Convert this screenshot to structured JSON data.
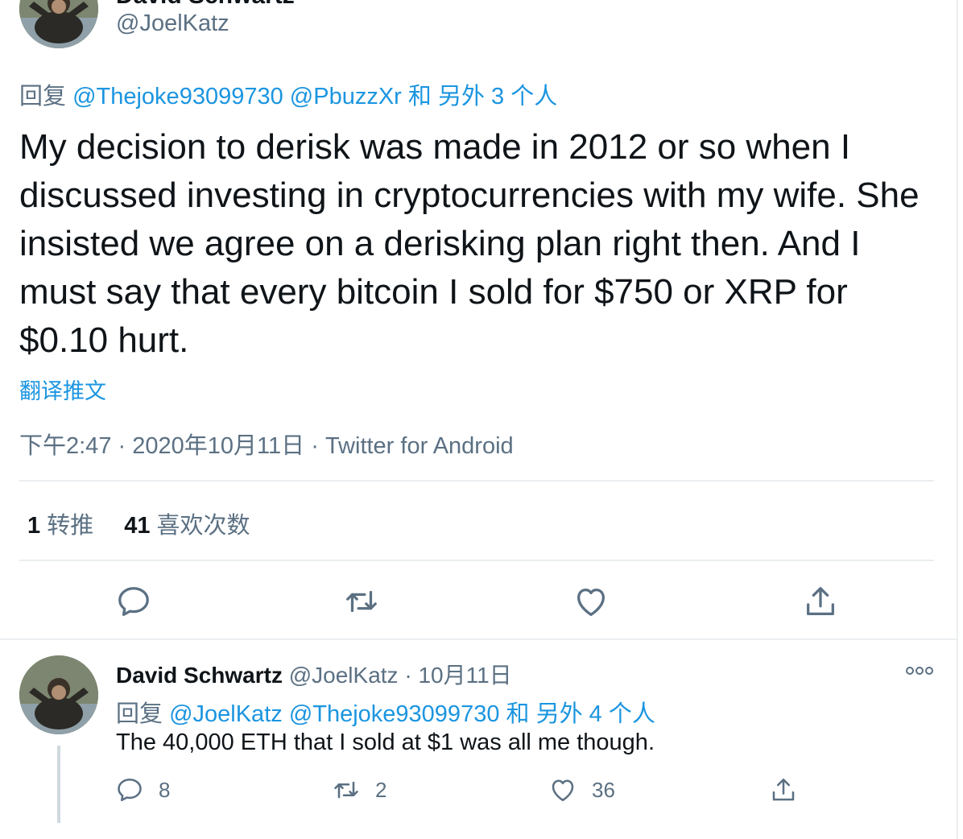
{
  "colors": {
    "text": "#0f1419",
    "secondary": "#5b7083",
    "link": "#1b95e0",
    "divider": "#ebeef0"
  },
  "main_tweet": {
    "author_name": "David Schwartz",
    "handle": "@JoelKatz",
    "reply_prefix": "回复",
    "reply_mention_1": "@Thejoke93099730",
    "reply_mention_2": "@PbuzzXr",
    "reply_suffix": "和 另外 3 个人",
    "text": "My decision to derisk was made in 2012 or so when I discussed investing in cryptocurrencies with my wife. She insisted we agree on a derisking plan right then. And I must say that every bitcoin I sold for $750 or XRP for $0.10 hurt.",
    "translate_label": "翻译推文",
    "time": "下午2:47",
    "separator": "·",
    "date": "2020年10月11日",
    "source": "Twitter for Android",
    "retweet_count": "1",
    "retweet_label": "转推",
    "like_count": "41",
    "like_label": "喜欢次数",
    "actions": [
      "reply-icon",
      "retweet-icon",
      "like-icon",
      "share-icon"
    ]
  },
  "reply_tweet": {
    "author_name": "David Schwartz",
    "handle": "@JoelKatz",
    "separator": "·",
    "date": "10月11日",
    "reply_prefix": "回复",
    "reply_mention_1": "@JoelKatz",
    "reply_mention_2": "@Thejoke93099730",
    "reply_suffix": "和 另外 4 个人",
    "text": "The 40,000 ETH that I sold at $1 was all me though.",
    "reply_count": "8",
    "retweet_count": "2",
    "like_count": "36"
  }
}
